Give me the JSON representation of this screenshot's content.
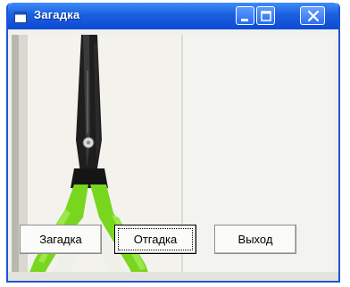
{
  "window": {
    "title": "Загадка",
    "icon": "window-app-icon",
    "controls": [
      "minimize-icon",
      "maximize-icon",
      "close-icon"
    ],
    "colors": {
      "titlebar": "#1b5fe0",
      "frame": "#1f53d6",
      "client": "#f0f0ed"
    }
  },
  "image": {
    "subject": "scissors-icon",
    "colors": {
      "blade": "#1a1a1a",
      "handle": "#7ad61c"
    }
  },
  "buttons": {
    "riddle_label": "Загадка",
    "answer_label": "Отгадка",
    "exit_label": "Выход"
  }
}
